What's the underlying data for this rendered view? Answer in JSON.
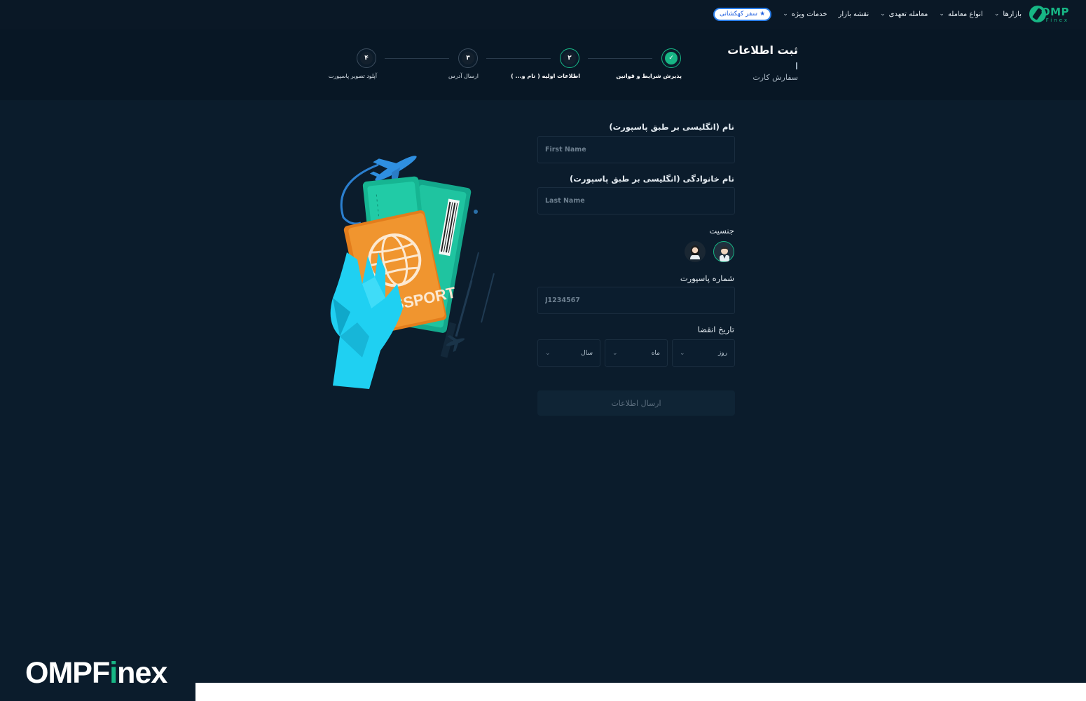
{
  "nav": {
    "brand": "OMP",
    "brand_sub": "Finex",
    "items": [
      {
        "label": "بازارها",
        "icon": "chevron-down-icon"
      },
      {
        "label": "انواع معامله",
        "icon": "chevron-down-icon"
      },
      {
        "label": "معامله تعهدی",
        "icon": "chevron-down-icon"
      },
      {
        "label": "نقشه بازار"
      },
      {
        "label": "خدمات ویژه",
        "icon": "chevron-down-icon"
      }
    ],
    "galaxy": "سفر کهکشانی"
  },
  "header": {
    "title": "ثبت اطلاعات",
    "subtitle": "سفارش کارت"
  },
  "steps": [
    {
      "number": "✓",
      "label": "پذیرش شرایط و قوانین",
      "state": "done"
    },
    {
      "number": "۲",
      "label": "اطلاعات اولیه ( نام و... )",
      "state": "active"
    },
    {
      "number": "۳",
      "label": "ارسال آدرس",
      "state": "pending"
    },
    {
      "number": "۴",
      "label": "آپلود تصویر پاسپورت",
      "state": "pending"
    }
  ],
  "form": {
    "first_name_label": "نام (انگلیسی بر طبق پاسپورت)",
    "first_name_placeholder": "First Name",
    "last_name_label": "نام خانوادگی (انگلیسی بر طبق پاسپورت)",
    "last_name_placeholder": "Last Name",
    "gender_label": "جنسیت",
    "passport_label": "شماره پاسپورت",
    "passport_placeholder": "J1234567",
    "expiry_label": "تاریخ انقضا",
    "day": "روز",
    "month": "ماه",
    "year": "سال",
    "submit": "ارسال اطلاعات"
  },
  "illustration": {
    "passport_text": "SSPORT"
  },
  "watermark": {
    "before": "OMPF",
    "highlight": "i",
    "after": "nex"
  },
  "colors": {
    "accent": "#17b685",
    "background": "#0b1c2c",
    "header": "#081725"
  }
}
